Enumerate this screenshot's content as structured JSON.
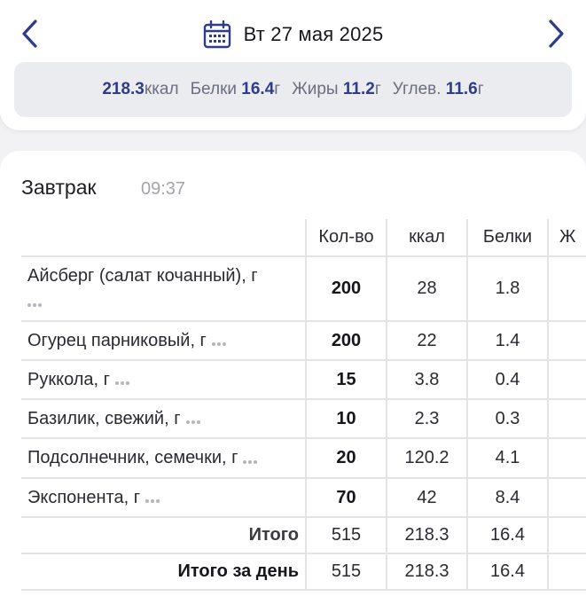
{
  "header": {
    "date_label": "Вт 27 мая 2025",
    "icons": {
      "prev": "chevron-left-icon",
      "next": "chevron-right-icon",
      "calendar": "calendar-icon"
    },
    "accent_color": "#2f3c8c"
  },
  "summary": {
    "kcal_value": "218.3",
    "kcal_unit": "ккал",
    "protein_label": "Белки",
    "protein_value": "16.4",
    "protein_unit": "г",
    "fat_label": "Жиры",
    "fat_value": "11.2",
    "fat_unit": "г",
    "carb_label": "Углев.",
    "carb_value": "11.6",
    "carb_unit": "г"
  },
  "meal": {
    "title": "Завтрак",
    "time": "09:37",
    "columns": [
      "Кол-во",
      "ккал",
      "Белки",
      "Ж"
    ],
    "rows": [
      {
        "name": "Айсберг (салат кочанный), г",
        "qty": "200",
        "kcal": "28",
        "protein": "1.8"
      },
      {
        "name": "Огурец парниковый, г",
        "qty": "200",
        "kcal": "22",
        "protein": "1.4"
      },
      {
        "name": "Руккола, г",
        "qty": "15",
        "kcal": "3.8",
        "protein": "0.4"
      },
      {
        "name": "Базилик, свежий, г",
        "qty": "10",
        "kcal": "2.3",
        "protein": "0.3"
      },
      {
        "name": "Подсолнечник, семечки, г",
        "qty": "20",
        "kcal": "120.2",
        "protein": "4.1"
      },
      {
        "name": "Экспонента, г",
        "qty": "70",
        "kcal": "42",
        "protein": "8.4"
      }
    ],
    "total": {
      "label": "Итого",
      "qty": "515",
      "kcal": "218.3",
      "protein": "16.4"
    },
    "day_total": {
      "label": "Итого за день",
      "qty": "515",
      "kcal": "218.3",
      "protein": "16.4"
    }
  }
}
